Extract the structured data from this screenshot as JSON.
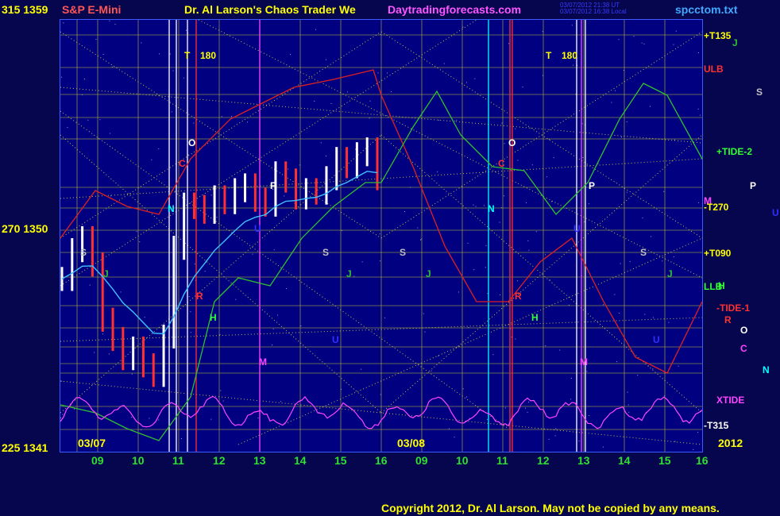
{
  "header": {
    "left_label": "315  1359",
    "instrument": "S&P E-Mini",
    "title": "Dr. Al Larson's Chaos Trader We",
    "site": "Daytradingforecasts.com",
    "file": "spcctom.txt",
    "stamp_line1": "03/07/2012 21:38 UT",
    "stamp_line2": "03/07/2012 16:38 Local"
  },
  "y_labels": [
    {
      "text": "315  1359",
      "value": 1359
    },
    {
      "text": "270  1350",
      "value": 1350
    },
    {
      "text": "225  1341",
      "value": 1341
    }
  ],
  "dates": [
    "03/07",
    "03/08"
  ],
  "year": "2012",
  "copyright": "Copyright 2012, Dr. Al Larson. May not be copied by any means.",
  "right_labels": [
    {
      "text": "+T135",
      "color": "#ffff00"
    },
    {
      "text": "J",
      "color": "#30c030"
    },
    {
      "text": "ULB",
      "color": "#ff3030"
    },
    {
      "text": "S",
      "color": "#c0c0c0"
    },
    {
      "text": "+TIDE-2",
      "color": "#30ff30"
    },
    {
      "text": "P",
      "color": "#ffffff"
    },
    {
      "text": "M",
      "color": "#ff44ff"
    },
    {
      "text": "-T270",
      "color": "#ffff00"
    },
    {
      "text": "U",
      "color": "#3030ff"
    },
    {
      "text": "+T090",
      "color": "#ffff00"
    },
    {
      "text": "LLB",
      "color": "#30ff30"
    },
    {
      "text": "H",
      "color": "#30ff30"
    },
    {
      "text": "-TIDE-1",
      "color": "#ff3030"
    },
    {
      "text": "R",
      "color": "#ff3030"
    },
    {
      "text": "O",
      "color": "#ffffff"
    },
    {
      "text": "C",
      "color": "#ff44ff"
    },
    {
      "text": "N",
      "color": "#00ffff"
    },
    {
      "text": "XTIDE",
      "color": "#ff44ff"
    },
    {
      "text": "-T315",
      "color": "#ffffff"
    }
  ],
  "chart_labels": [
    {
      "text": "T",
      "color": "#ffff00"
    },
    {
      "text": "180",
      "color": "#ffff00"
    },
    {
      "text": "T",
      "color": "#ffff00"
    },
    {
      "text": "180",
      "color": "#ffff00"
    },
    {
      "text": "O",
      "color": "#ffffff"
    },
    {
      "text": "O",
      "color": "#ffffff"
    },
    {
      "text": "C",
      "color": "#ff3030"
    },
    {
      "text": "C",
      "color": "#ff3030"
    },
    {
      "text": "N",
      "color": "#00ffff"
    },
    {
      "text": "N",
      "color": "#00ffff"
    },
    {
      "text": "P",
      "color": "#ffffff"
    },
    {
      "text": "P",
      "color": "#ffffff"
    },
    {
      "text": "S",
      "color": "#c0c0c0"
    },
    {
      "text": "S",
      "color": "#c0c0c0"
    },
    {
      "text": "S",
      "color": "#c0c0c0"
    },
    {
      "text": "S",
      "color": "#c0c0c0"
    },
    {
      "text": "J",
      "color": "#30c030"
    },
    {
      "text": "J",
      "color": "#30c030"
    },
    {
      "text": "J",
      "color": "#30c030"
    },
    {
      "text": "J",
      "color": "#30c030"
    },
    {
      "text": "H",
      "color": "#30ff30"
    },
    {
      "text": "H",
      "color": "#30ff30"
    },
    {
      "text": "R",
      "color": "#ff3030"
    },
    {
      "text": "R",
      "color": "#ff3030"
    },
    {
      "text": "U",
      "color": "#3030ff"
    },
    {
      "text": "U",
      "color": "#3030ff"
    },
    {
      "text": "U",
      "color": "#3030ff"
    },
    {
      "text": "U",
      "color": "#3030ff"
    },
    {
      "text": "M",
      "color": "#ff44ff"
    },
    {
      "text": "M",
      "color": "#ff44ff"
    }
  ],
  "chart_data": {
    "type": "line",
    "title": "Dr. Al Larson's Chaos Trader We",
    "instrument": "S&P E-Mini",
    "x_ticks": [
      "09",
      "10",
      "11",
      "12",
      "13",
      "14",
      "15",
      "16",
      "09",
      "10",
      "11",
      "12",
      "13",
      "14",
      "15",
      "16"
    ],
    "ylim": [
      1341,
      1359
    ],
    "price_bars_03_07": [
      1348.2,
      1349.4,
      1349.9,
      1348.8,
      1346.5,
      1345.7,
      1344.9,
      1345.3,
      1344.6,
      1344.2,
      1345.8,
      1349.5,
      1351.3,
      1351.2,
      1351.0,
      1351.6,
      1351.4,
      1351.9,
      1352.1,
      1351.5,
      1351.3,
      1352.6,
      1352.3,
      1351.6,
      1351.9,
      1351.8,
      1352.4,
      1353.2,
      1352.9,
      1353.4,
      1353.6,
      1352.4
    ],
    "colors": {
      "background": "#000080",
      "grid": "#c8c832",
      "price_bar": "#ffffff",
      "down_bar": "#ff3030",
      "xtide": "#ff44ff",
      "ma_cyan": "#3fc0ff",
      "red_curve": "#e02020",
      "green_curve": "#30c030"
    },
    "grid": true
  }
}
